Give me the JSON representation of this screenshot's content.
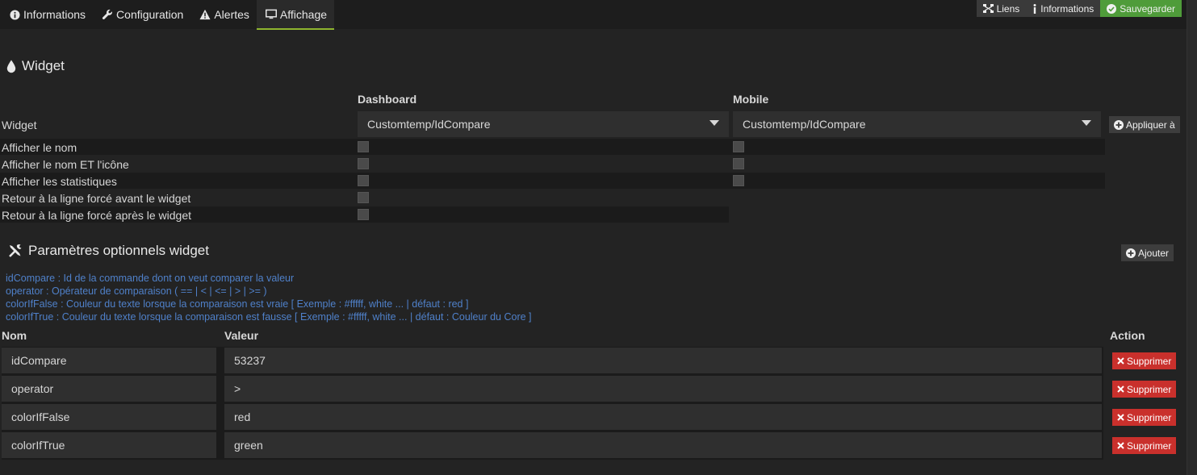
{
  "tabs": [
    {
      "label": "Informations",
      "icon": "info-circle-icon"
    },
    {
      "label": "Configuration",
      "icon": "wrench-icon"
    },
    {
      "label": "Alertes",
      "icon": "warning-icon"
    },
    {
      "label": "Affichage",
      "icon": "monitor-icon",
      "active": true
    }
  ],
  "top_buttons": {
    "links": "Liens",
    "info": "Informations",
    "save": "Sauvegarder"
  },
  "widget_section": {
    "title": "Widget",
    "col_dashboard": "Dashboard",
    "col_mobile": "Mobile",
    "widget_label": "Widget",
    "dashboard_select": "Customtemp/IdCompare",
    "mobile_select": "Customtemp/IdCompare",
    "apply_button": "Appliquer à",
    "options": [
      {
        "label": "Afficher le nom",
        "dashboard": false,
        "mobile": false
      },
      {
        "label": "Afficher le nom ET l'icône",
        "dashboard": false,
        "mobile": false
      },
      {
        "label": "Afficher les statistiques",
        "dashboard": false,
        "mobile": false
      },
      {
        "label": "Retour à la ligne forcé avant le widget",
        "dashboard": false
      },
      {
        "label": "Retour à la ligne forcé après le widget",
        "dashboard": false
      }
    ]
  },
  "params_section": {
    "title": "Paramètres optionnels widget",
    "add_button": "Ajouter",
    "help": [
      "idCompare : Id de la commande dont on veut comparer la valeur",
      "operator : Opérateur de comparaison ( == | < | <= | > | >= )",
      "colorIfFalse : Couleur du texte lorsque la comparaison est vraie [ Exemple : #fffff, white ... | défaut : red ]",
      "colorIfTrue : Couleur du texte lorsque la comparaison est fausse [ Exemple : #fffff, white ... | défaut : Couleur du Core ]"
    ],
    "col_name": "Nom",
    "col_value": "Valeur",
    "col_action": "Action",
    "delete_label": "Supprimer",
    "rows": [
      {
        "name": "idCompare",
        "value": "53237"
      },
      {
        "name": "operator",
        "value": ">"
      },
      {
        "name": "colorIfFalse",
        "value": "red"
      },
      {
        "name": "colorIfTrue",
        "value": "green"
      }
    ]
  },
  "colors": {
    "accent": "#8fb52f",
    "save": "#4f9c3a",
    "danger": "#c9302c",
    "help_text": "#4f80c9"
  }
}
